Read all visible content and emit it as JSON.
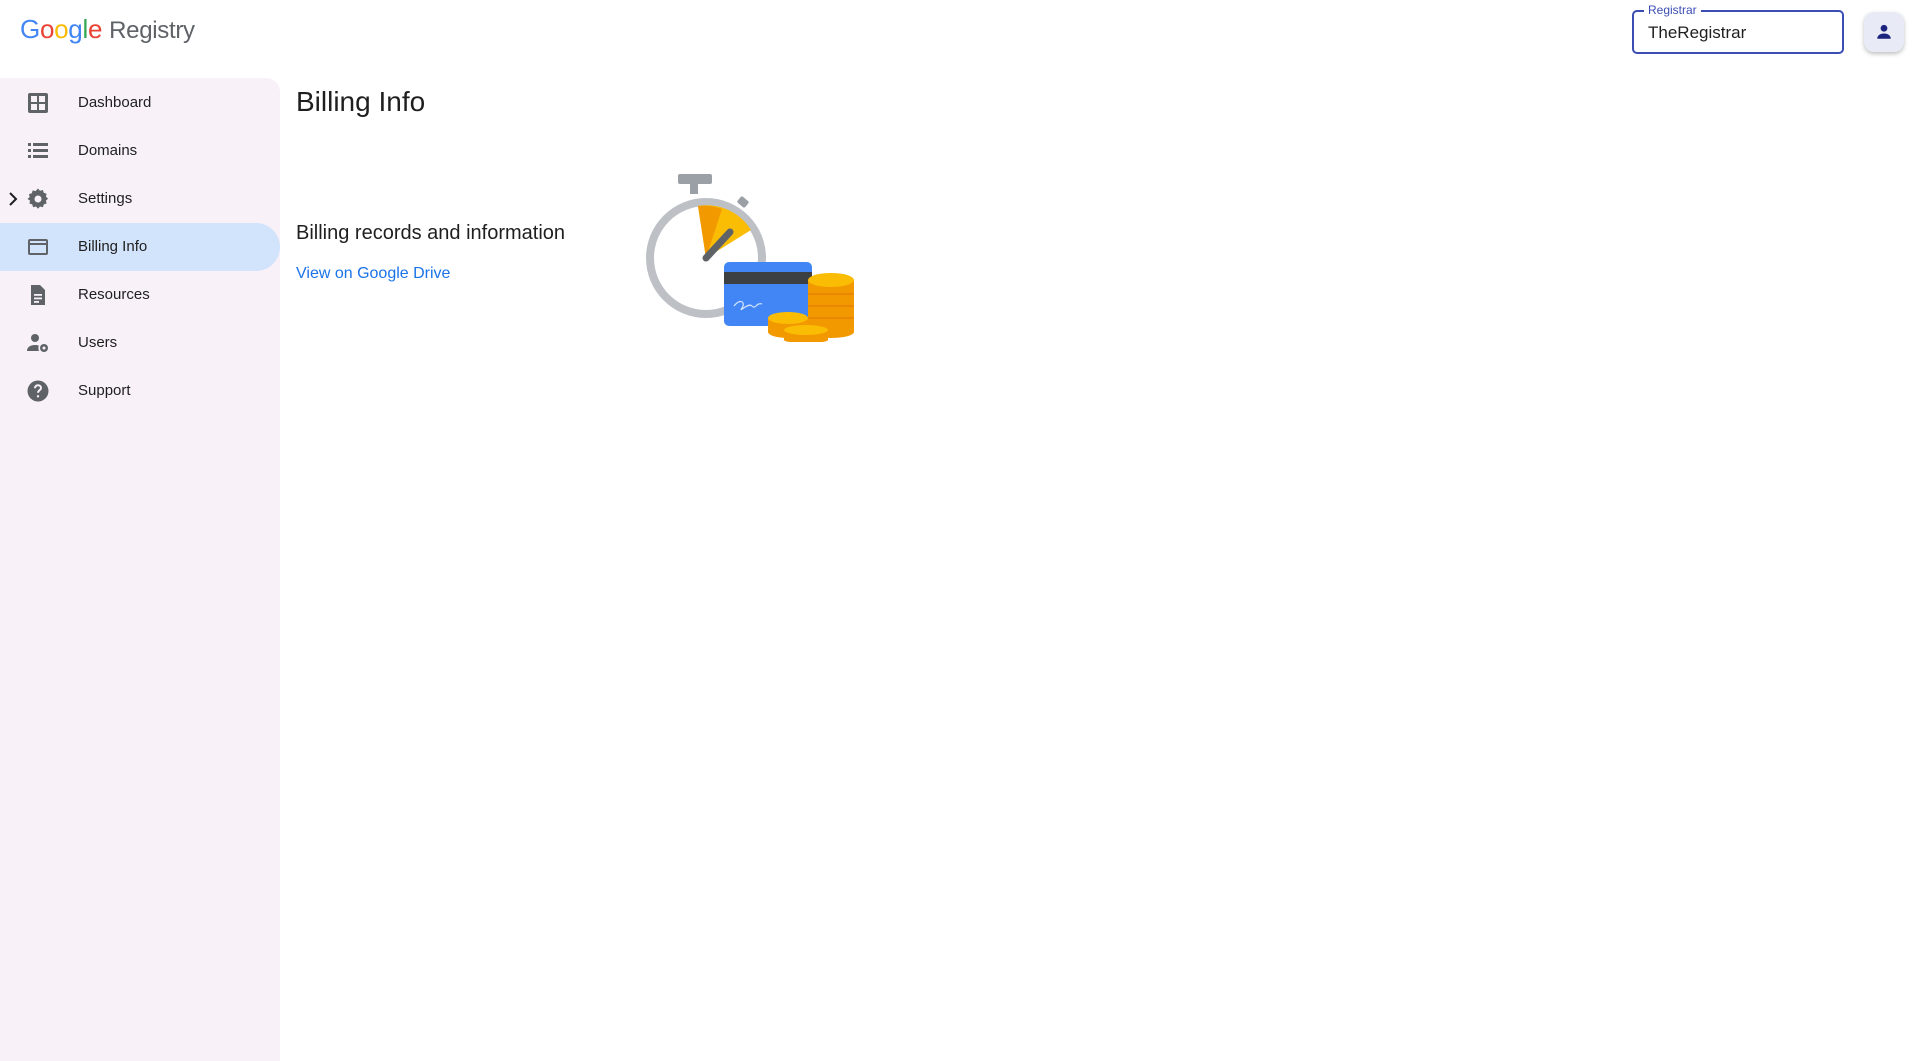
{
  "header": {
    "logo": {
      "letters": [
        "G",
        "o",
        "o",
        "g",
        "l",
        "e"
      ],
      "product": "Registry"
    },
    "registrar_select": {
      "label": "Registrar",
      "value": "TheRegistrar"
    },
    "account_icon": "person-icon"
  },
  "sidebar": {
    "items": [
      {
        "label": "Dashboard",
        "icon": "dashboard-icon",
        "active": false
      },
      {
        "label": "Domains",
        "icon": "list-icon",
        "active": false
      },
      {
        "label": "Settings",
        "icon": "gear-icon",
        "active": false,
        "expandable": true
      },
      {
        "label": "Billing Info",
        "icon": "credit-card-icon",
        "active": true
      },
      {
        "label": "Resources",
        "icon": "document-icon",
        "active": false
      },
      {
        "label": "Users",
        "icon": "manage-accounts-icon",
        "active": false
      },
      {
        "label": "Support",
        "icon": "help-icon",
        "active": false
      }
    ]
  },
  "main": {
    "title": "Billing Info",
    "section_heading": "Billing records and information",
    "drive_link": "View on Google Drive",
    "illustration": "stopwatch-card-coins-illustration"
  },
  "colors": {
    "accent": "#3c4eb4",
    "link": "#1a73e8",
    "sidebar_bg": "#f8f1f8",
    "active_item_bg": "#d2e3fc"
  }
}
